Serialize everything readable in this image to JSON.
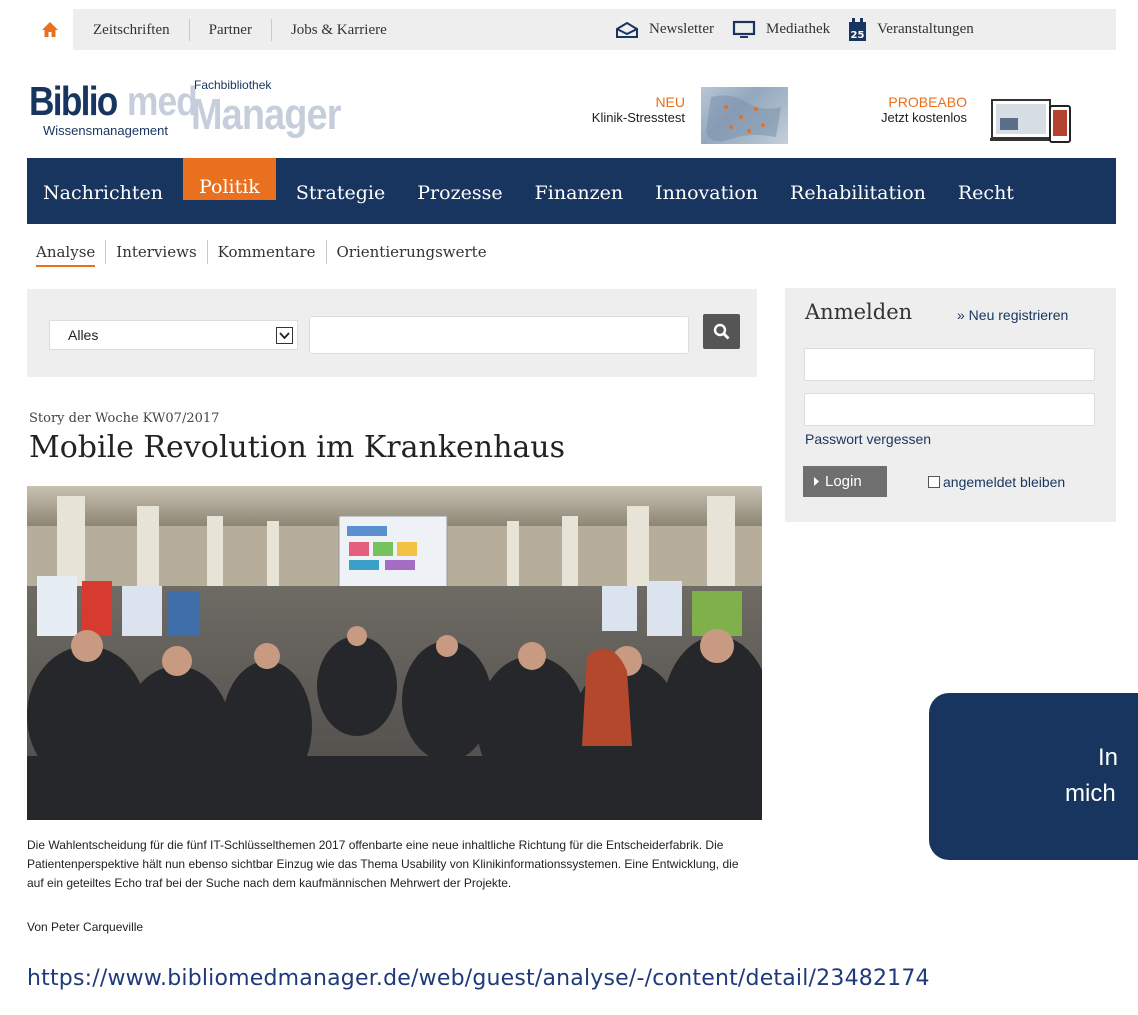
{
  "topbar": {
    "links": [
      "Zeitschriften",
      "Partner",
      "Jobs & Karriere"
    ],
    "newsletter": "Newsletter",
    "mediathek": "Mediathek",
    "calendar_day": "25",
    "veranstaltungen": "Veranstaltungen"
  },
  "logo": {
    "biblio": "Biblio",
    "med": "med",
    "fachbibliothek": "Fachbibliothek",
    "manager": "Manager",
    "wissensmanagement": "Wissensmanagement"
  },
  "promos": [
    {
      "highlight": "NEU",
      "text": "Klinik-Stresstest"
    },
    {
      "highlight": "PROBEABO",
      "text": "Jetzt kostenlos"
    }
  ],
  "main_nav": [
    "Nachrichten",
    "Politik",
    "Strategie",
    "Prozesse",
    "Finanzen",
    "Innovation",
    "Rehabilitation",
    "Recht"
  ],
  "main_nav_active": "Politik",
  "sub_nav": [
    "Analyse",
    "Interviews",
    "Kommentare",
    "Orientierungswerte"
  ],
  "sub_nav_active": "Analyse",
  "search": {
    "select_value": "Alles",
    "query": ""
  },
  "article": {
    "kicker": "Story der Woche KW07/2017",
    "headline": "Mobile Revolution im Krankenhaus",
    "caption": "Die Wahlentscheidung für die fünf IT-Schlüsselthemen 2017 offenbarte eine neue inhaltliche Richtung für die Entscheiderfabrik. Die Patientenperspektive hält nun ebenso sichtbar Einzug wie das Thema Usability von Klinikinformationssystemen. Eine Entwicklung, die auf ein geteiltes Echo traf bei der Suche nach dem kaufmännischen Mehrwert der Projekte.",
    "author": "Von Peter Carqueville"
  },
  "login": {
    "title": "Anmelden",
    "register": "» Neu registrieren",
    "forgot": "Passwort vergessen",
    "button": "Login",
    "remember": "angemeldet bleiben"
  },
  "popup": {
    "line1": "In",
    "line2": "mich"
  },
  "url": "https://www.bibliomedmanager.de/web/guest/analyse/-/content/detail/23482174",
  "colors": {
    "navy": "#17355f",
    "orange": "#e8701e",
    "panel": "#eeeeee"
  }
}
